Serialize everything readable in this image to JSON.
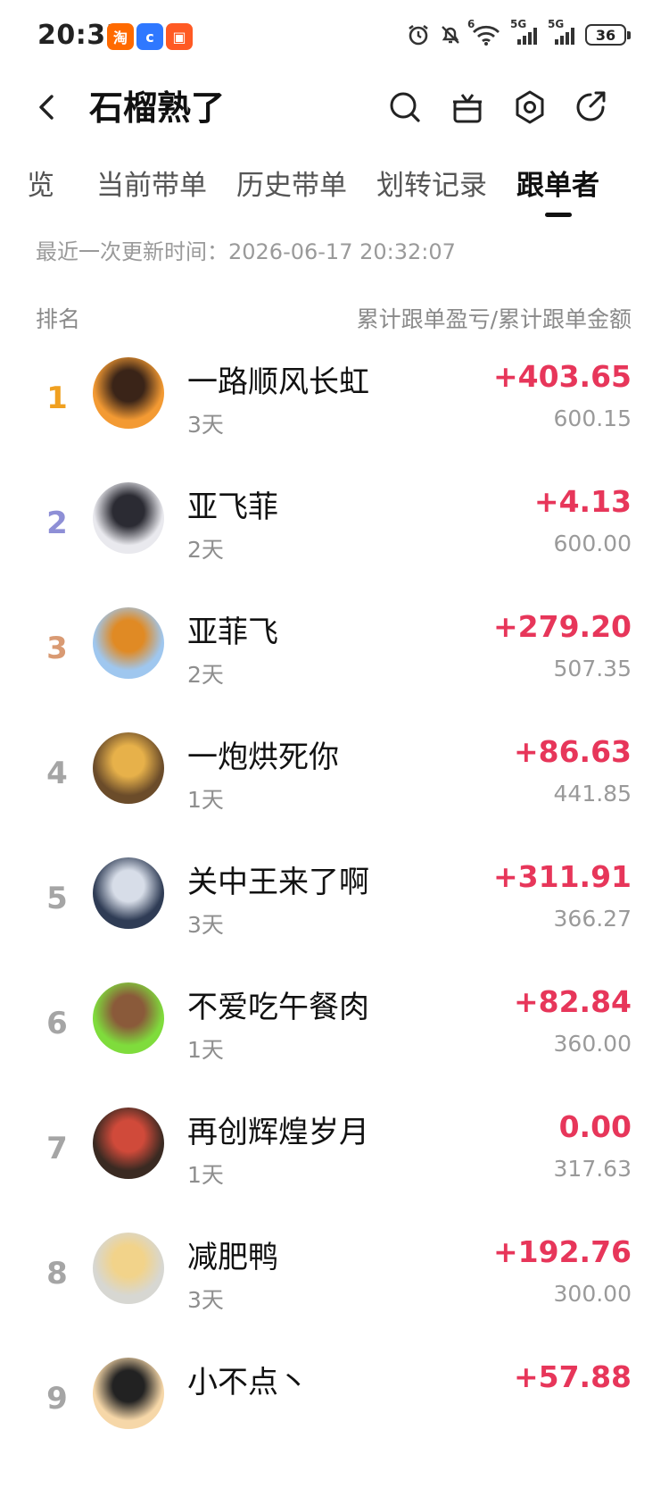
{
  "status_bar": {
    "time": "20:33",
    "app_icons": [
      {
        "icon": "taobao-icon",
        "glyph": "淘",
        "color": "#ff6a00"
      },
      {
        "icon": "baidu-netdisk-icon",
        "glyph": "c",
        "color": "#2f78ff"
      },
      {
        "icon": "red-app-icon",
        "glyph": "▣",
        "color": "#ff5a24"
      }
    ],
    "network_labels": [
      "6",
      "5G",
      "5G"
    ],
    "battery": "36"
  },
  "header": {
    "title": "石榴熟了",
    "icons": [
      "search-icon",
      "gift-icon",
      "settings-icon",
      "share-icon"
    ]
  },
  "tabs": [
    {
      "label": "览",
      "active": false
    },
    {
      "label": "当前带单",
      "active": false
    },
    {
      "label": "历史带单",
      "active": false
    },
    {
      "label": "划转记录",
      "active": false
    },
    {
      "label": "跟单者",
      "active": true
    }
  ],
  "update_text": "最近一次更新时间：2026-06-17 20:32:07",
  "columns": {
    "rank": "排名",
    "value": "累计跟单盈亏/累计跟单金额"
  },
  "followers": [
    {
      "rank": "1",
      "name": "一路顺风长虹",
      "days": "3天",
      "pnl": "+403.65",
      "amount": "600.15",
      "rank_color": "#f0a020",
      "avatar_colors": [
        "#f39a33",
        "#3a2418"
      ]
    },
    {
      "rank": "2",
      "name": "亚飞菲",
      "days": "2天",
      "pnl": "+4.13",
      "amount": "600.00",
      "rank_color": "#8e8fd6",
      "avatar_colors": [
        "#e9e9ee",
        "#2b2b33"
      ]
    },
    {
      "rank": "3",
      "name": "亚菲飞",
      "days": "2天",
      "pnl": "+279.20",
      "amount": "507.35",
      "rank_color": "#d99a73",
      "avatar_colors": [
        "#9fc7ef",
        "#e08a24"
      ]
    },
    {
      "rank": "4",
      "name": "一炮烘死你",
      "days": "1天",
      "pnl": "+86.63",
      "amount": "441.85",
      "rank_color": "#a5a5a5",
      "avatar_colors": [
        "#6b4c2a",
        "#e7b14a"
      ]
    },
    {
      "rank": "5",
      "name": "关中王来了啊",
      "days": "3天",
      "pnl": "+311.91",
      "amount": "366.27",
      "rank_color": "#a5a5a5",
      "avatar_colors": [
        "#2f3c55",
        "#d7dde8"
      ]
    },
    {
      "rank": "6",
      "name": "不爱吃午餐肉",
      "days": "1天",
      "pnl": "+82.84",
      "amount": "360.00",
      "rank_color": "#a5a5a5",
      "avatar_colors": [
        "#7fdc3c",
        "#8a5a3a"
      ]
    },
    {
      "rank": "7",
      "name": "再创辉煌岁月",
      "days": "1天",
      "pnl": "0.00",
      "amount": "317.63",
      "rank_color": "#a5a5a5",
      "avatar_colors": [
        "#3a2a22",
        "#d04a3a"
      ]
    },
    {
      "rank": "8",
      "name": "减肥鸭",
      "days": "3天",
      "pnl": "+192.76",
      "amount": "300.00",
      "rank_color": "#a5a5a5",
      "avatar_colors": [
        "#d7d7d2",
        "#f2d38a"
      ]
    },
    {
      "rank": "9",
      "name": "小不点丶",
      "days": "",
      "pnl": "+57.88",
      "amount": "",
      "rank_color": "#a5a5a5",
      "avatar_colors": [
        "#f6d7a8",
        "#222222"
      ]
    }
  ]
}
